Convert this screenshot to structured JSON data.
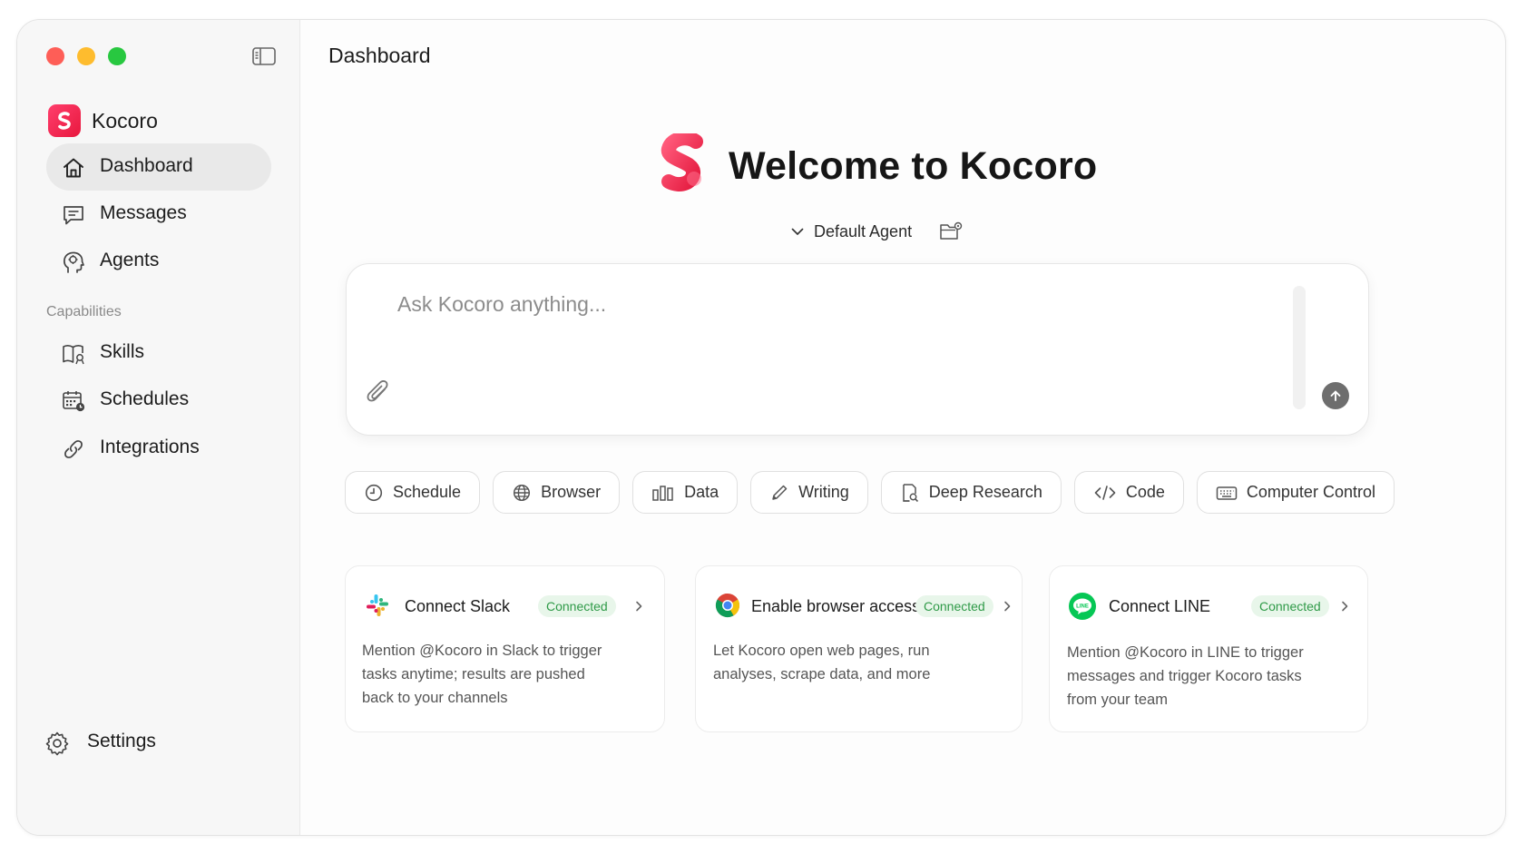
{
  "sidebar": {
    "brand": "Kocoro",
    "nav": [
      {
        "label": "Dashboard",
        "icon": "home-icon",
        "active": true
      },
      {
        "label": "Messages",
        "icon": "chat-icon"
      },
      {
        "label": "Agents",
        "icon": "brain-head-icon"
      }
    ],
    "capabilities_label": "Capabilities",
    "capabilities": [
      {
        "label": "Skills",
        "icon": "book-icon"
      },
      {
        "label": "Schedules",
        "icon": "calendar-clock-icon"
      },
      {
        "label": "Integrations",
        "icon": "link-icon"
      }
    ],
    "settings_label": "Settings"
  },
  "main": {
    "page_title": "Dashboard",
    "welcome_title": "Welcome to Kocoro",
    "agent_select": "Default Agent",
    "composer": {
      "placeholder": "Ask Kocoro anything..."
    },
    "chips": [
      {
        "label": "Schedule",
        "icon": "clock-icon"
      },
      {
        "label": "Browser",
        "icon": "globe-icon"
      },
      {
        "label": "Data",
        "icon": "bar-chart-icon"
      },
      {
        "label": "Writing",
        "icon": "pencil-icon"
      },
      {
        "label": "Deep Research",
        "icon": "document-search-icon"
      },
      {
        "label": "Code",
        "icon": "code-icon"
      },
      {
        "label": "Computer Control",
        "icon": "keyboard-icon"
      }
    ],
    "cards": [
      {
        "title": "Connect Slack",
        "status": "Connected",
        "icon": "slack-icon",
        "description": [
          "Mention @Kocoro in Slack to trigger",
          "tasks anytime; results are pushed",
          "back to your channels"
        ]
      },
      {
        "title": "Enable browser access",
        "status": "Connected",
        "icon": "chrome-icon",
        "description": [
          "Let Kocoro open web pages, run",
          "analyses, scrape data, and more"
        ]
      },
      {
        "title": "Connect LINE",
        "status": "Connected",
        "icon": "line-icon",
        "description": [
          "Mention @Kocoro in LINE to trigger",
          "messages and trigger Kocoro tasks",
          "from your team"
        ]
      }
    ]
  },
  "colors": {
    "brand": "#f0244d",
    "connected_bg": "#e8f6ea",
    "connected_text": "#2f9a48",
    "active_nav": "#e9e9e9"
  }
}
